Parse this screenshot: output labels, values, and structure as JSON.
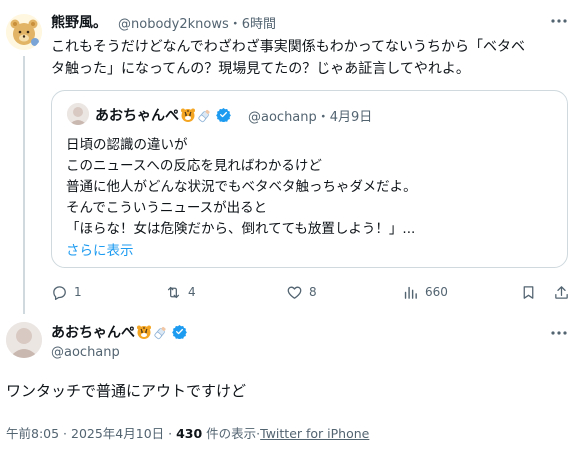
{
  "reply_tweet": {
    "display_name": "熊野風。",
    "handle": "@nobody2knows",
    "time": "・6時間",
    "body_line1": "これもそうだけどなんでわざわざ事実関係もわかってないうちから「ベタベ",
    "body_line2": "タ触った」になってんの？現場見てたの？じゃあ証言してやれよ。",
    "more_icon": "more-dots-icon"
  },
  "quoted_tweet": {
    "display_name": "あおちゃんぺ",
    "handle": "@aochanp",
    "time": "・4月9日",
    "lines": [
      "日頃の認識の違いが",
      "このニュースへの反応を見ればわかるけど",
      "普通に他人がどんな状況でもベタベタ触っちゃダメだよ。",
      "そんでこういうニュースが出ると",
      "「ほらな！女は危険だから、倒れてても放置しよう！」..."
    ],
    "show_more": "さらに表示"
  },
  "actions": {
    "reply_count": "1",
    "retweet_count": "4",
    "like_count": "8",
    "view_count": "660"
  },
  "main_tweet": {
    "display_name": "あおちゃんぺ",
    "handle": "@aochanp",
    "text": "ワンタッチで普通にアウトですけど",
    "timestamp": "午前8:05 · 2025年4月10日 · ",
    "views": "430",
    "views_label": " 件の表示·",
    "source": "Twitter for iPhone"
  },
  "colors": {
    "text": "#0f1419",
    "secondary": "#536471",
    "accent": "#1d9bf0",
    "border": "#cfd9de"
  }
}
